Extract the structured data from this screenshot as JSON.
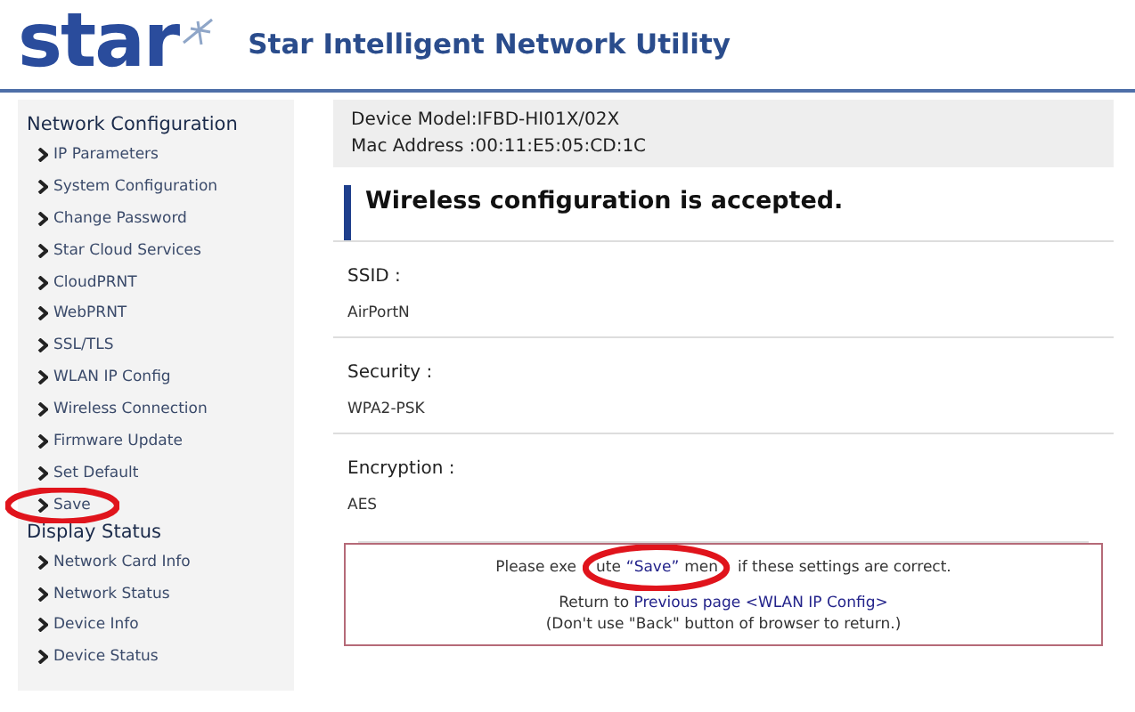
{
  "header": {
    "logo": "star",
    "title": "Star Intelligent Network Utility"
  },
  "sidebar": {
    "sections": [
      {
        "title": "Network Configuration",
        "items": [
          {
            "label": "IP Parameters",
            "circled": false
          },
          {
            "label": "System Configuration",
            "circled": false
          },
          {
            "label": "Change Password",
            "circled": false
          },
          {
            "label": "Star Cloud Services",
            "circled": false
          },
          {
            "label": "CloudPRNT",
            "circled": false
          },
          {
            "label": "WebPRNT",
            "circled": false
          },
          {
            "label": "SSL/TLS",
            "circled": false
          },
          {
            "label": "WLAN IP Config",
            "circled": false
          },
          {
            "label": "Wireless Connection",
            "circled": false
          },
          {
            "label": "Firmware Update",
            "circled": false
          },
          {
            "label": "Set Default",
            "circled": false
          },
          {
            "label": "Save",
            "circled": true
          }
        ]
      },
      {
        "title": "Display Status",
        "items": [
          {
            "label": "Network Card Info",
            "circled": false
          },
          {
            "label": "Network Status",
            "circled": false
          },
          {
            "label": "Device Info",
            "circled": false
          },
          {
            "label": "Device Status",
            "circled": false
          }
        ]
      }
    ]
  },
  "device": {
    "model": "Device Model:IFBD-HI01X/02X",
    "mac": "Mac Address :00:11:E5:05:CD:1C"
  },
  "heading": "Wireless configuration is accepted.",
  "fields": [
    {
      "label": "SSID :",
      "value": "AirPortN"
    },
    {
      "label": "Security :",
      "value": "WPA2-PSK"
    },
    {
      "label": "Encryption :",
      "value": "AES"
    }
  ],
  "notice": {
    "before": "Please exe",
    "pre_link": "ute",
    "link": "“Save”",
    "post_link": "men",
    "after": "if these settings are correct.",
    "link_circled": true,
    "return_text": "Return to",
    "return_link": "Previous page <WLAN IP Config>",
    "warning": "(Don't use \"Back\" button of browser to return.)"
  }
}
